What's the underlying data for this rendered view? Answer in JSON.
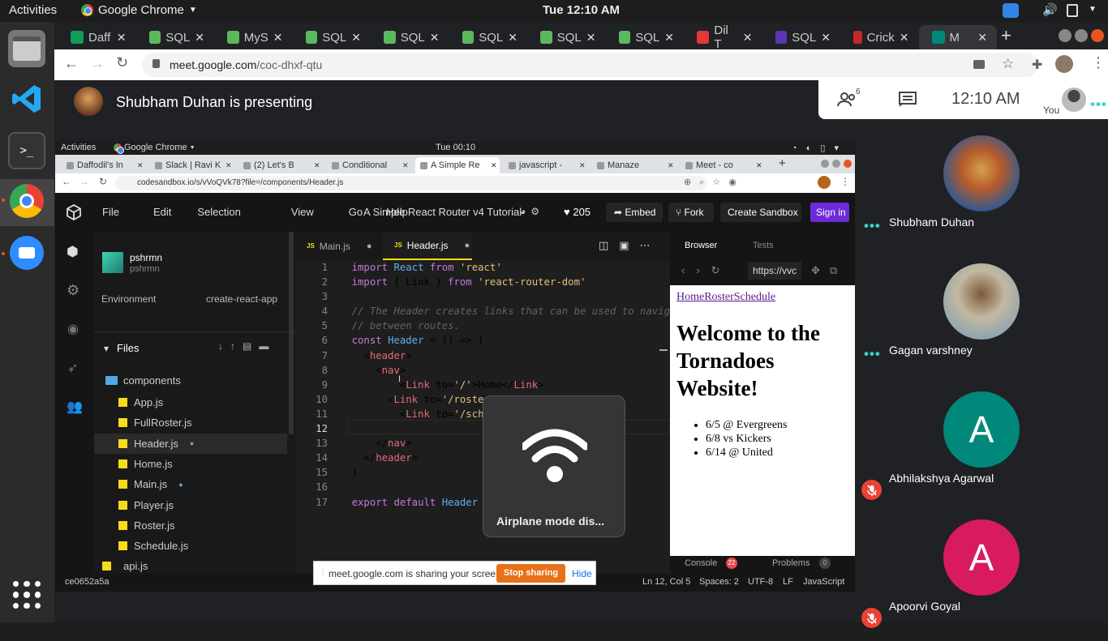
{
  "topbar": {
    "activities": "Activities",
    "app_name": "Google Chrome",
    "clock": "Tue 12:10 AM"
  },
  "browser": {
    "tabs": [
      {
        "label": "Daff",
        "color": "#0f9d58"
      },
      {
        "label": "SQL",
        "color": "#5cb85c"
      },
      {
        "label": "MyS",
        "color": "#5cb85c"
      },
      {
        "label": "SQL",
        "color": "#5cb85c"
      },
      {
        "label": "SQL",
        "color": "#5cb85c"
      },
      {
        "label": "SQL",
        "color": "#5cb85c"
      },
      {
        "label": "SQL",
        "color": "#5cb85c"
      },
      {
        "label": "SQL",
        "color": "#5cb85c"
      },
      {
        "label": "Dil T",
        "color": "#e53935"
      },
      {
        "label": "SQL",
        "color": "#5e35b1"
      },
      {
        "label": "Crick",
        "color": "#c62828"
      },
      {
        "label": "M",
        "color": "#00897b"
      }
    ],
    "url_host": "meet.google.com",
    "url_path": "/coc-dhxf-qtu"
  },
  "meet": {
    "presenting_text": "Shubham Duhan is presenting",
    "people_count": "6",
    "clock": "12:10  AM",
    "you_label": "You",
    "sharing_banner": "meet.google.com is sharing your screen.",
    "stop_sharing": "Stop sharing",
    "hide": "Hide",
    "participants": [
      {
        "name": "Shubham Duhan",
        "state": "speaking"
      },
      {
        "name": "Gagan varshney",
        "state": "speaking"
      },
      {
        "name": "Abhilakshya Agarwal",
        "state": "muted",
        "initial": "A",
        "color": "#00897b"
      },
      {
        "name": "Apoorvi Goyal",
        "state": "muted",
        "initial": "A",
        "color": "#d81b60"
      }
    ]
  },
  "shared_screen": {
    "topbar": {
      "activities": "Activities",
      "app": "Google Chrome",
      "clock": "Tue 00:10"
    },
    "tabs": [
      "Daffodil's In",
      "Slack | Ravi K",
      "(2) Let's B",
      "Conditional",
      "A Simple Re",
      "javascript - ",
      "Manaze",
      "Meet - co"
    ],
    "url": "codesandbox.io/s/vVoQVk78?file=/components/Header.js",
    "menu": [
      "File",
      "Edit",
      "Selection",
      "View",
      "Go",
      "Help"
    ],
    "project_title": "A Simple React Router v4 Tutorial",
    "likes": "205",
    "embed": "Embed",
    "fork": "Fork",
    "create_sandbox": "Create Sandbox",
    "sign_in": "Sign in",
    "user": "pshrmn",
    "user_sub": "pshrmn",
    "environment_label": "Environment",
    "environment_value": "create-react-app",
    "files_label": "Files",
    "folder": "components",
    "files": [
      "App.js",
      "FullRoster.js",
      "Header.js",
      "Home.js",
      "Main.js",
      "Player.js",
      "Roster.js",
      "Schedule.js"
    ],
    "api_file": "api.js",
    "editor_tabs": [
      "Main.js",
      "Header.js"
    ],
    "code_lines": [
      "import React from 'react'",
      "import { Link } from 'react-router-dom'",
      "",
      "// The Header creates links that can be used to navig",
      "// between routes.",
      "const Header = () => (",
      "  <header>",
      "    <nav>",
      "        <Link to='/'>Home</Link>",
      "      <Link to='/roste",
      "        <Link to='/sche",
      "",
      "    </nav>",
      "  </header>",
      ")",
      "",
      "export default Header"
    ],
    "browser_tab": "Browser",
    "tests_tab": "Tests",
    "preview_url": "https://vvc",
    "preview_links": "HomeRosterSchedule",
    "preview_heading": "Welcome to the Tornadoes Website!",
    "preview_items": [
      "6/5 @ Evergreens",
      "6/8 vs Kickers",
      "6/14 @ United"
    ],
    "console_label": "Console",
    "console_count": "22",
    "problems_label": "Problems",
    "problems_count": "0",
    "status": {
      "commit": "ce0652a5a",
      "position": "Ln 12, Col 5",
      "spaces": "Spaces: 2",
      "encoding": "UTF-8",
      "eol": "LF",
      "language": "JavaScript"
    },
    "osd": "Airplane mode dis..."
  }
}
